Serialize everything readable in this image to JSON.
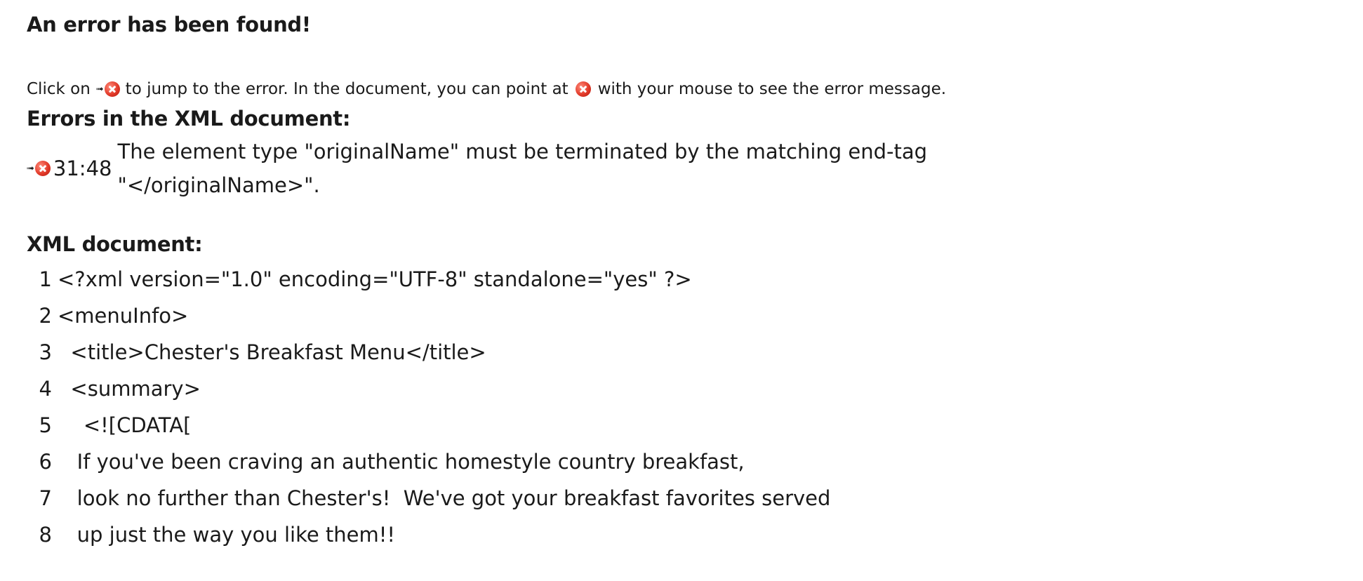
{
  "header": {
    "title": "An error has been found!"
  },
  "hint": {
    "prefix": "Click on",
    "middle": "to jump to the error. In the document, you can point at",
    "suffix": "with your mouse to see the error message."
  },
  "errors": {
    "heading": "Errors in the XML document:",
    "items": [
      {
        "location": "31:48",
        "message": "The element type \"originalName\" must be terminated by the matching end-tag \"</originalName>\"."
      }
    ]
  },
  "document": {
    "heading": "XML document:",
    "lines": [
      {
        "num": "1",
        "text": "<?xml version=\"1.0\" encoding=\"UTF-8\" standalone=\"yes\" ?>"
      },
      {
        "num": "2",
        "text": "<menuInfo>"
      },
      {
        "num": "3",
        "text": "  <title>Chester's Breakfast Menu</title>"
      },
      {
        "num": "4",
        "text": "  <summary>"
      },
      {
        "num": "5",
        "text": "    <![CDATA["
      },
      {
        "num": "6",
        "text": "   If you've been craving an authentic homestyle country breakfast,"
      },
      {
        "num": "7",
        "text": "   look no further than Chester's!  We've got your breakfast favorites served"
      },
      {
        "num": "8",
        "text": "   up just the way you like them!!"
      }
    ]
  },
  "icons": {
    "jump": "jump-arrow-icon",
    "error": "error-x-icon"
  },
  "colors": {
    "error_icon": "#e23b2a",
    "text": "#1a1a1a",
    "background": "#ffffff"
  }
}
